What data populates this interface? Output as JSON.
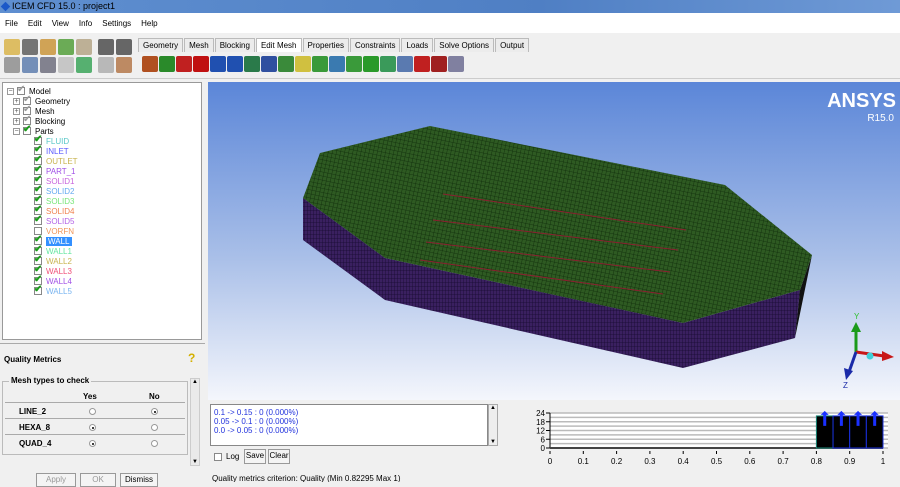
{
  "window": {
    "title": "ICEM CFD 15.0 : project1"
  },
  "menu": [
    "File",
    "Edit",
    "View",
    "Info",
    "Settings",
    "Help"
  ],
  "tabs": [
    {
      "label": "Geometry"
    },
    {
      "label": "Mesh"
    },
    {
      "label": "Blocking"
    },
    {
      "label": "Edit Mesh",
      "active": true
    },
    {
      "label": "Properties"
    },
    {
      "label": "Constraints"
    },
    {
      "label": "Loads"
    },
    {
      "label": "Solve Options"
    },
    {
      "label": "Output"
    }
  ],
  "tree": {
    "root": "Model",
    "groups": [
      "Geometry",
      "Mesh",
      "Blocking",
      "Parts"
    ],
    "parts": [
      {
        "name": "FLUID",
        "color": "#5ac8c8",
        "checked": true
      },
      {
        "name": "INLET",
        "color": "#5a5aff",
        "checked": true
      },
      {
        "name": "OUTLET",
        "color": "#c8b450",
        "checked": true
      },
      {
        "name": "PART_1",
        "color": "#a050e6",
        "checked": true
      },
      {
        "name": "SOLID1",
        "color": "#c864dc",
        "checked": true
      },
      {
        "name": "SOLID2",
        "color": "#64aaf0",
        "checked": true
      },
      {
        "name": "SOLID3",
        "color": "#78e678",
        "checked": true
      },
      {
        "name": "SOLID4",
        "color": "#f08250",
        "checked": true
      },
      {
        "name": "SOLID5",
        "color": "#b464e6",
        "checked": true
      },
      {
        "name": "VORFN",
        "color": "#f0965a",
        "checked": false
      },
      {
        "name": "WALL",
        "color": "#ffffff",
        "checked": true,
        "selected": true
      },
      {
        "name": "WALL1",
        "color": "#64e6a0",
        "checked": true
      },
      {
        "name": "WALL2",
        "color": "#c8b450",
        "checked": true
      },
      {
        "name": "WALL3",
        "color": "#f05078",
        "checked": true
      },
      {
        "name": "WALL4",
        "color": "#a050e6",
        "checked": true
      },
      {
        "name": "WALL5",
        "color": "#78b4f0",
        "checked": true
      }
    ]
  },
  "quality": {
    "title": "Quality Metrics",
    "group_title": "Mesh types to check",
    "col_yes": "Yes",
    "col_no": "No",
    "rows": [
      {
        "type": "LINE_2",
        "yes": false
      },
      {
        "type": "HEXA_8",
        "yes": true
      },
      {
        "type": "QUAD_4",
        "yes": true
      }
    ],
    "buttons": {
      "apply": "Apply",
      "ok": "OK",
      "dismiss": "Dismiss"
    }
  },
  "viewport": {
    "brand": "ANSYS",
    "version": "R15.0",
    "axes": {
      "y": "Y",
      "z": "Z"
    }
  },
  "messages": [
    "0.1 -> 0.15 : 0 (0.000%)",
    "0.05 -> 0.1 : 0 (0.000%)",
    "0.0 -> 0.05 : 0 (0.000%)"
  ],
  "msg_controls": {
    "log": "Log",
    "save": "Save",
    "clear": "Clear"
  },
  "histogram": {
    "y_ticks": [
      "24",
      "18",
      "12",
      "6",
      "0"
    ],
    "x_ticks": [
      "0",
      "0.1",
      "0.2",
      "0.3",
      "0.4",
      "0.5",
      "0.6",
      "0.7",
      "0.8",
      "0.9",
      "1"
    ],
    "bins": [
      {
        "from": 0.8,
        "to": 0.85,
        "count": 22
      },
      {
        "from": 0.85,
        "to": 0.9,
        "count": 22
      },
      {
        "from": 0.9,
        "to": 0.95,
        "count": 22
      },
      {
        "from": 0.95,
        "to": 1.0,
        "count": 22
      }
    ],
    "ymax": 24
  },
  "status": "Quality metrics criterion: Quality (Min 0.82295 Max 1)"
}
